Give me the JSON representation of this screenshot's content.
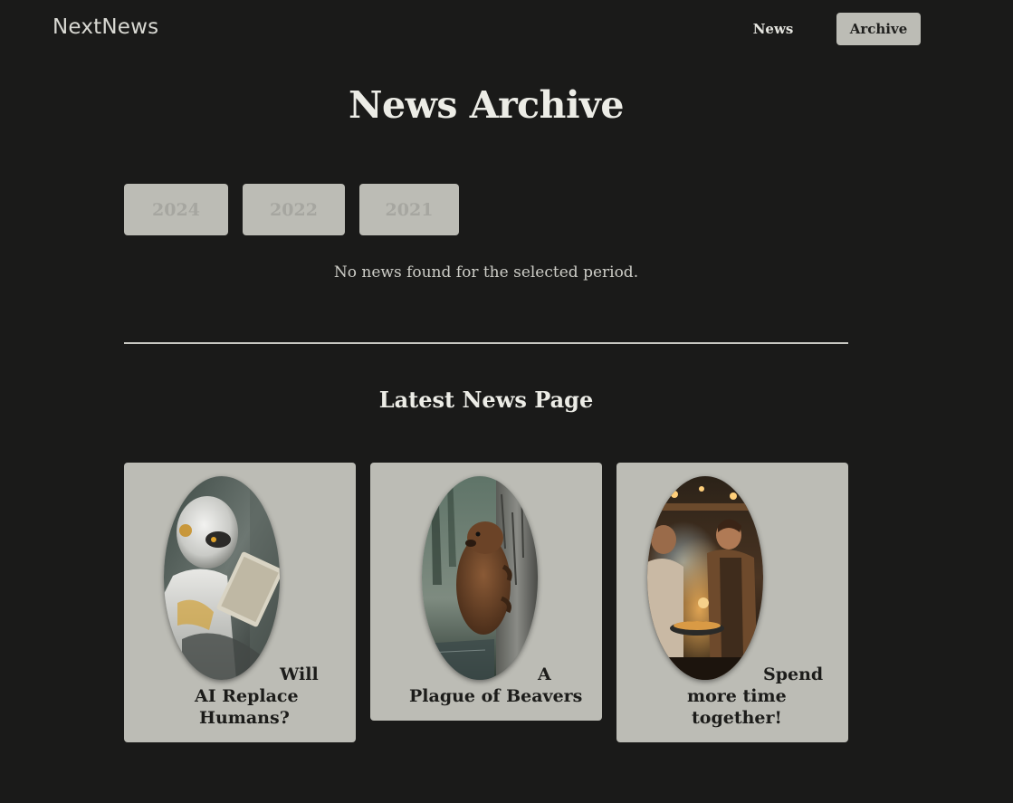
{
  "header": {
    "logo": "NextNews",
    "nav": [
      {
        "label": "News",
        "active": false
      },
      {
        "label": "Archive",
        "active": true
      }
    ]
  },
  "page": {
    "title": "News Archive",
    "years": [
      "2024",
      "2022",
      "2021"
    ],
    "empty_message": "No news found for the selected period.",
    "latest_title": "Latest News Page"
  },
  "news": [
    {
      "title": "Will AI Replace Humans?",
      "lines": [
        "Will",
        "AI Replace",
        "Humans?"
      ],
      "image": "robot-reading-image"
    },
    {
      "title": "A Plague of Beavers",
      "lines": [
        "A",
        "Plague of Beavers"
      ],
      "image": "beaver-climbing-tree-image"
    },
    {
      "title": "Spend more time together!",
      "lines": [
        "Spend",
        "more time",
        "together!"
      ],
      "image": "people-cooking-image"
    }
  ],
  "colors": {
    "background": "#1a1a19",
    "surface": "#bcbcb5",
    "text_light": "#e2e2dc",
    "text_dark": "#1c1c1a"
  }
}
